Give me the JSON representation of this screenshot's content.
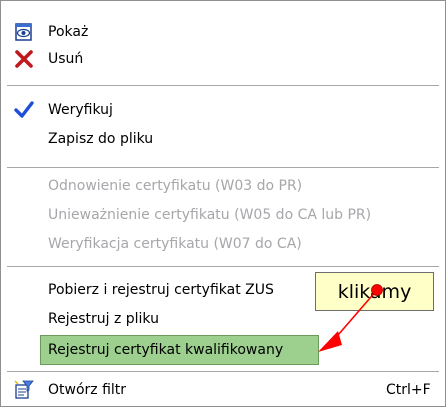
{
  "menu": {
    "items": [
      {
        "label": "Pokaż",
        "icon": "eye-document-icon",
        "enabled": true
      },
      {
        "label": "Usuń",
        "icon": "red-x-icon",
        "enabled": true
      },
      {
        "label": "Weryfikuj",
        "icon": "checkmark-icon",
        "enabled": true
      },
      {
        "label": "Zapisz do pliku",
        "enabled": true
      },
      {
        "label": "Odnowienie certyfikatu (W03 do PR)",
        "enabled": false
      },
      {
        "label": "Unieważnienie certyfikatu (W05 do CA lub PR)",
        "enabled": false
      },
      {
        "label": "Weryfikacja certyfikatu (W07 do CA)",
        "enabled": false
      },
      {
        "label": "Pobierz i rejestruj certyfikat ZUS",
        "enabled": true
      },
      {
        "label": "Rejestruj z pliku",
        "enabled": true
      },
      {
        "label": "Rejestruj certyfikat kwalifikowany",
        "enabled": true,
        "highlighted": true
      },
      {
        "label": "Otwórz filtr",
        "icon": "filter-icon",
        "shortcut": "Ctrl+F",
        "enabled": true
      }
    ]
  },
  "callout": {
    "text": "klikamy"
  },
  "colors": {
    "highlight": "#9dcf8f",
    "disabled_text": "#a7a6aa",
    "callout_bg": "#ffffc8",
    "arrow": "#ff0000",
    "check": "#1f4fd6"
  }
}
